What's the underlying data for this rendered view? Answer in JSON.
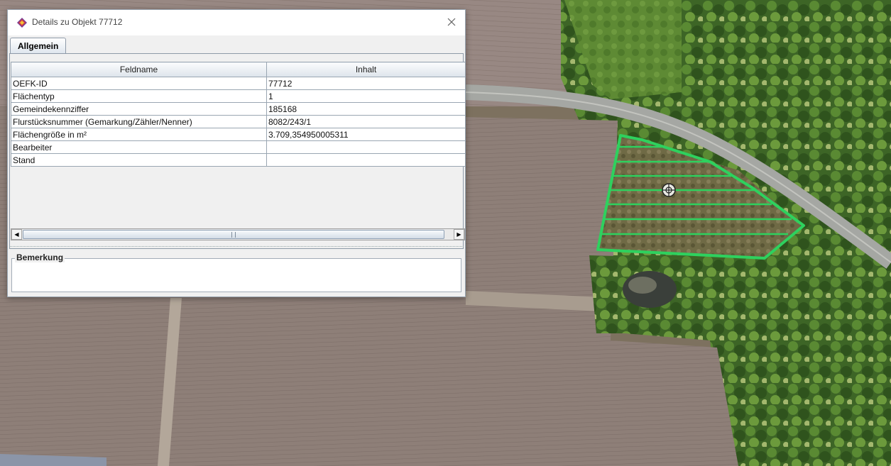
{
  "dialog": {
    "title": "Details zu Objekt 77712",
    "tab_label": "Allgemein",
    "columns": {
      "name": "Feldname",
      "value": "Inhalt"
    },
    "rows": [
      {
        "name": "OEFK-ID",
        "value": "77712"
      },
      {
        "name": "Flächentyp",
        "value": "1"
      },
      {
        "name": "Gemeindekennziffer",
        "value": "185168"
      },
      {
        "name": "Flurstücksnummer (Gemarkung/Zähler/Nenner)",
        "value": "8082/243/1"
      },
      {
        "name": "Flächengröße in m²",
        "value": "3.709,354950005311"
      },
      {
        "name": "Bearbeiter",
        "value": ""
      },
      {
        "name": "Stand",
        "value": ""
      }
    ],
    "remarks_label": "Bemerkung",
    "remarks_value": ""
  },
  "icons": {
    "app": "app-diamond-icon",
    "close": "close-icon",
    "scroll_left": "scroll-left-arrow-icon",
    "scroll_right": "scroll-right-arrow-icon",
    "map_target": "crosshair-target-icon"
  },
  "colors": {
    "polygon": "#2ed15e",
    "field": "#8f7f79",
    "forest": "#3f6a2a",
    "road": "#a7a9a5"
  }
}
